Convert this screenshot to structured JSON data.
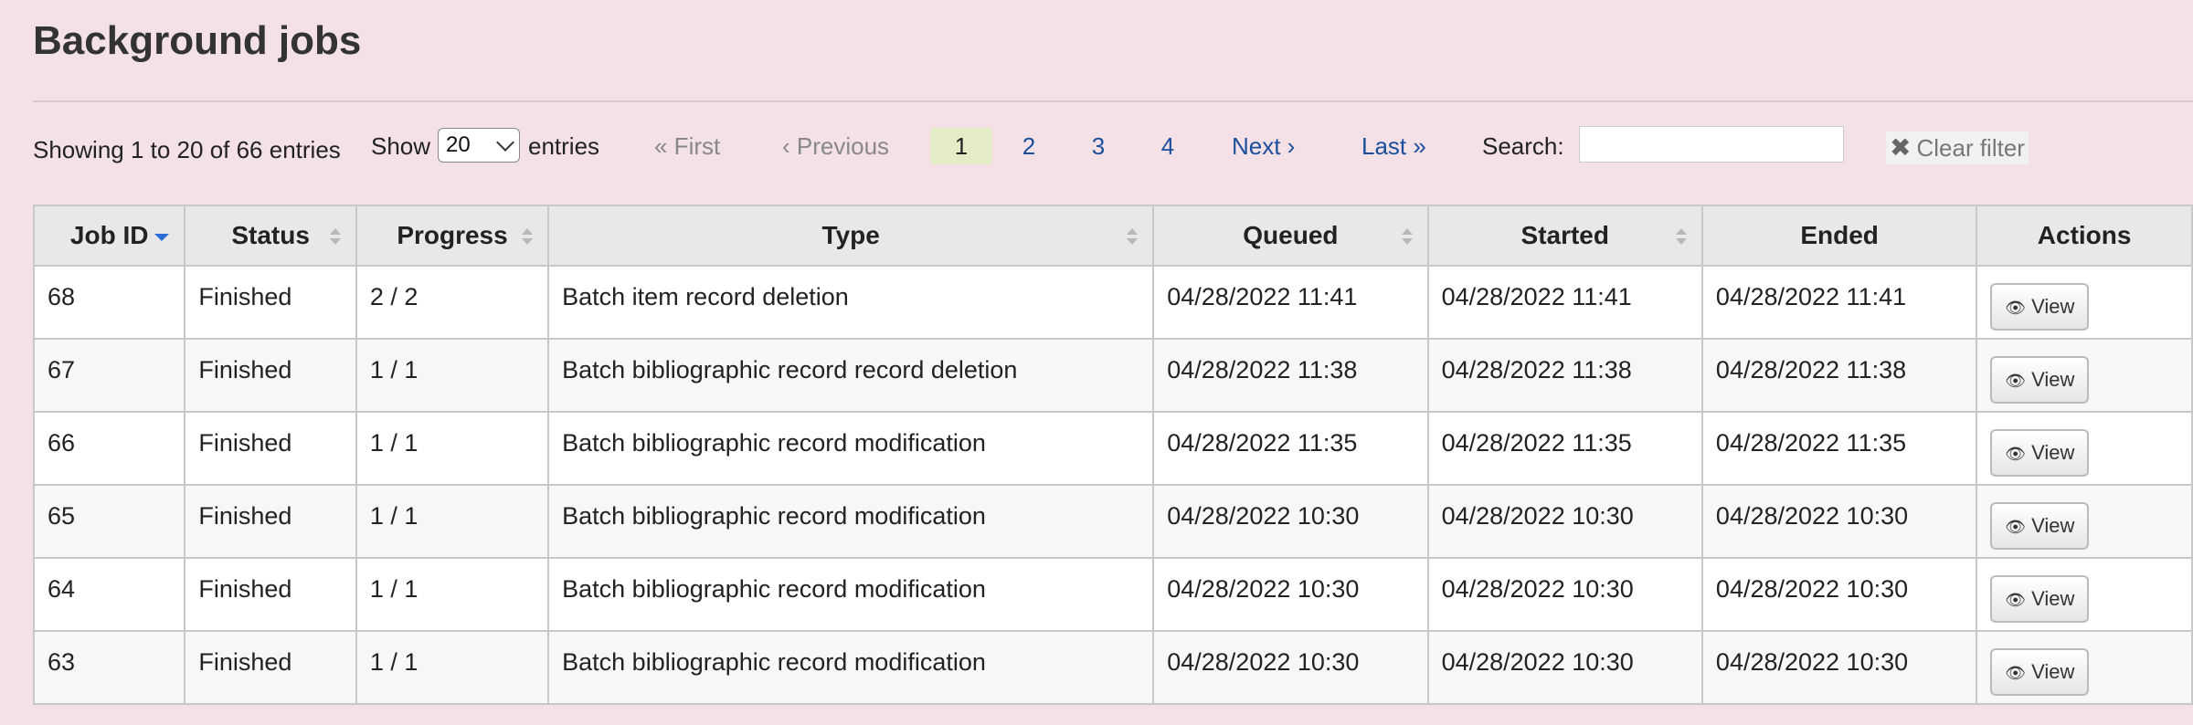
{
  "page": {
    "title": "Background jobs"
  },
  "toolbar": {
    "info": "Showing 1 to 20 of 66 entries",
    "show_label": "Show",
    "entries_value": "20",
    "entries_label": "entries",
    "first": "« First",
    "previous": "‹ Previous",
    "pages": [
      "1",
      "2",
      "3",
      "4"
    ],
    "next": "Next ›",
    "last": "Last »",
    "search_label": "Search:",
    "search_value": "",
    "clear_filter": "Clear filter"
  },
  "table": {
    "headers": [
      "Job ID",
      "Status",
      "Progress",
      "Type",
      "Queued",
      "Started",
      "Ended",
      "Actions"
    ],
    "view_label": "View",
    "rows": [
      {
        "id": "68",
        "status": "Finished",
        "progress": "2 / 2",
        "type": "Batch item record deletion",
        "queued": "04/28/2022 11:41",
        "started": "04/28/2022 11:41",
        "ended": "04/28/2022 11:41"
      },
      {
        "id": "67",
        "status": "Finished",
        "progress": "1 / 1",
        "type": "Batch bibliographic record record deletion",
        "queued": "04/28/2022 11:38",
        "started": "04/28/2022 11:38",
        "ended": "04/28/2022 11:38"
      },
      {
        "id": "66",
        "status": "Finished",
        "progress": "1 / 1",
        "type": "Batch bibliographic record modification",
        "queued": "04/28/2022 11:35",
        "started": "04/28/2022 11:35",
        "ended": "04/28/2022 11:35"
      },
      {
        "id": "65",
        "status": "Finished",
        "progress": "1 / 1",
        "type": "Batch bibliographic record modification",
        "queued": "04/28/2022 10:30",
        "started": "04/28/2022 10:30",
        "ended": "04/28/2022 10:30"
      },
      {
        "id": "64",
        "status": "Finished",
        "progress": "1 / 1",
        "type": "Batch bibliographic record modification",
        "queued": "04/28/2022 10:30",
        "started": "04/28/2022 10:30",
        "ended": "04/28/2022 10:30"
      },
      {
        "id": "63",
        "status": "Finished",
        "progress": "1 / 1",
        "type": "Batch bibliographic record modification",
        "queued": "04/28/2022 10:30",
        "started": "04/28/2022 10:30",
        "ended": "04/28/2022 10:30"
      }
    ]
  }
}
